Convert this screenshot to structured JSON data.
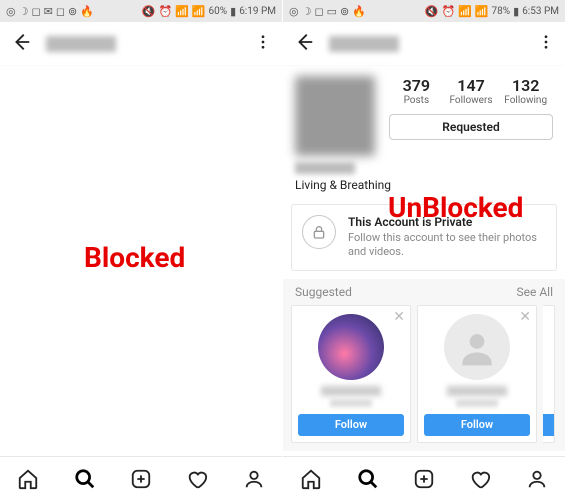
{
  "statusbar": {
    "left": {
      "battery_pct": "60%",
      "time": "6:19 PM"
    },
    "right": {
      "battery_pct": "78%",
      "time": "6:53 PM"
    }
  },
  "overlay": {
    "blocked": "Blocked",
    "unblocked": "UnBlocked"
  },
  "profile": {
    "stats": {
      "posts": {
        "n": "379",
        "label": "Posts"
      },
      "followers": {
        "n": "147",
        "label": "Followers"
      },
      "following": {
        "n": "132",
        "label": "Following"
      }
    },
    "requested_label": "Requested",
    "bio_line": "Living & Breathing"
  },
  "private": {
    "title": "This Account is Private",
    "subtitle": "Follow this account to see their photos and videos."
  },
  "suggested": {
    "header": "Suggested",
    "see_all": "See All",
    "follow_label": "Follow"
  }
}
